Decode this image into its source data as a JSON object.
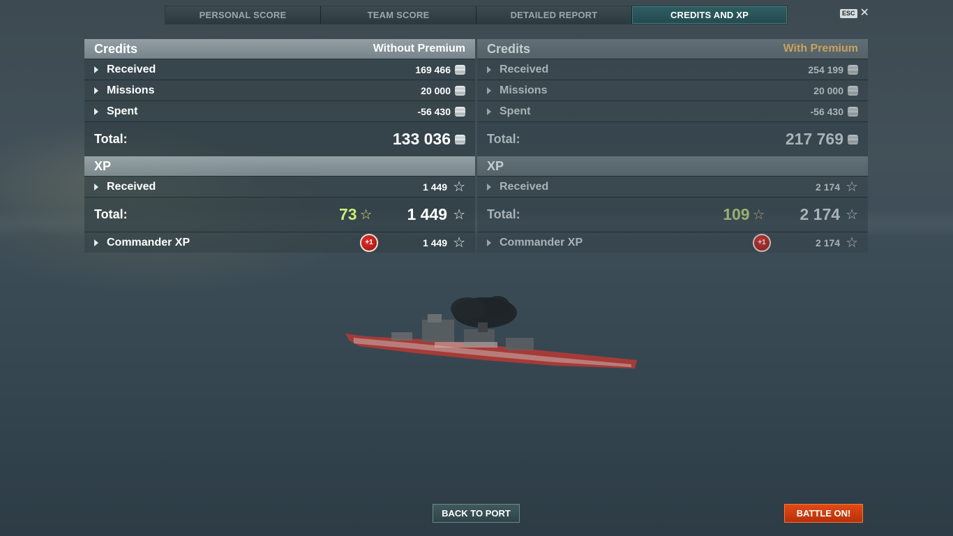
{
  "tabs": [
    {
      "label": "PERSONAL SCORE"
    },
    {
      "label": "TEAM SCORE"
    },
    {
      "label": "DETAILED REPORT"
    },
    {
      "label": "CREDITS AND XP"
    }
  ],
  "esc": {
    "key_label": "ESC",
    "close_glyph": "✕"
  },
  "without_premium": {
    "credits_header": "Credits",
    "tag": "Without Premium",
    "received_label": "Received",
    "received_value": "169 466",
    "missions_label": "Missions",
    "missions_value": "20 000",
    "spent_label": "Spent",
    "spent_value": "-56 430",
    "total_label": "Total:",
    "total_value": "133 036",
    "xp_header": "XP",
    "xp_received_label": "Received",
    "xp_received_value": "1 449",
    "xp_total_label": "Total:",
    "xp_bonus": "73",
    "xp_total_value": "1 449",
    "commander_label": "Commander XP",
    "commander_badge": "+1",
    "commander_value": "1 449"
  },
  "with_premium": {
    "credits_header": "Credits",
    "tag": "With Premium",
    "received_label": "Received",
    "received_value": "254 199",
    "missions_label": "Missions",
    "missions_value": "20 000",
    "spent_label": "Spent",
    "spent_value": "-56 430",
    "total_label": "Total:",
    "total_value": "217 769",
    "xp_header": "XP",
    "xp_received_label": "Received",
    "xp_received_value": "2 174",
    "xp_total_label": "Total:",
    "xp_bonus": "109",
    "xp_total_value": "2 174",
    "commander_label": "Commander XP",
    "commander_badge": "+1",
    "commander_value": "2 174"
  },
  "buttons": {
    "back_to_port": "BACK TO PORT",
    "battle_on": "BATTLE ON!"
  },
  "icons": {
    "credits": "credits-coin-icon",
    "xp": "star-icon",
    "expand": "triangle-right-icon"
  },
  "colors": {
    "active_tab": "#2f5e62",
    "premium_tag": "#c9a25a",
    "bonus_xp": "#c8ee78",
    "battle_button": "#e24a14"
  }
}
